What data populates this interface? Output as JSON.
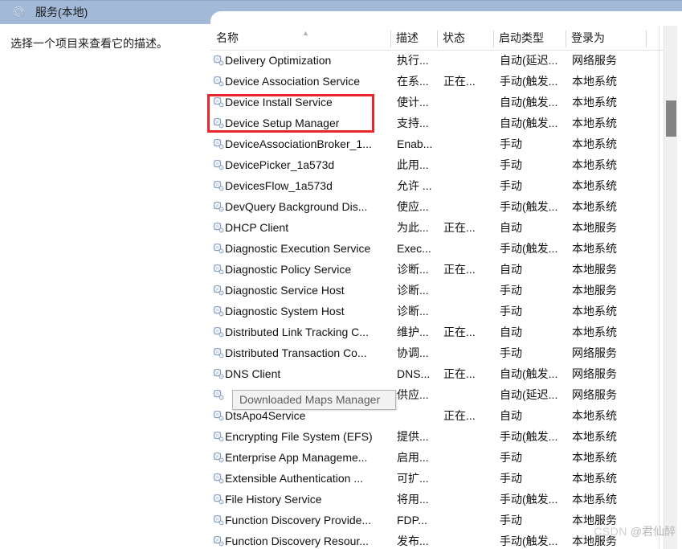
{
  "window": {
    "title": "服务(本地)",
    "title_icon": "services-gear-icon"
  },
  "left_pane": {
    "description": "选择一个项目来查看它的描述。"
  },
  "list": {
    "columns": [
      {
        "key": "name",
        "label": "名称",
        "sort": "ascending"
      },
      {
        "key": "desc",
        "label": "描述"
      },
      {
        "key": "state",
        "label": "状态"
      },
      {
        "key": "startup",
        "label": "启动类型"
      },
      {
        "key": "logon",
        "label": "登录为"
      }
    ],
    "rows": [
      {
        "name": "Delivery Optimization",
        "desc": "执行...",
        "state": "",
        "startup": "自动(延迟...",
        "logon": "网络服务"
      },
      {
        "name": "Device Association Service",
        "desc": "在系...",
        "state": "正在...",
        "startup": "手动(触发...",
        "logon": "本地系统"
      },
      {
        "name": "Device Install Service",
        "desc": "使计...",
        "state": "",
        "startup": "自动(触发...",
        "logon": "本地系统"
      },
      {
        "name": "Device Setup Manager",
        "desc": "支持...",
        "state": "",
        "startup": "自动(触发...",
        "logon": "本地系统"
      },
      {
        "name": "DeviceAssociationBroker_1...",
        "desc": "Enab...",
        "state": "",
        "startup": "手动",
        "logon": "本地系统"
      },
      {
        "name": "DevicePicker_1a573d",
        "desc": "此用...",
        "state": "",
        "startup": "手动",
        "logon": "本地系统"
      },
      {
        "name": "DevicesFlow_1a573d",
        "desc": "允许 ...",
        "state": "",
        "startup": "手动",
        "logon": "本地系统"
      },
      {
        "name": "DevQuery Background Dis...",
        "desc": "使应...",
        "state": "",
        "startup": "手动(触发...",
        "logon": "本地系统"
      },
      {
        "name": "DHCP Client",
        "desc": "为此...",
        "state": "正在...",
        "startup": "自动",
        "logon": "本地服务"
      },
      {
        "name": "Diagnostic Execution Service",
        "desc": "Exec...",
        "state": "",
        "startup": "手动(触发...",
        "logon": "本地系统"
      },
      {
        "name": "Diagnostic Policy Service",
        "desc": "诊断...",
        "state": "正在...",
        "startup": "自动",
        "logon": "本地服务"
      },
      {
        "name": "Diagnostic Service Host",
        "desc": "诊断...",
        "state": "",
        "startup": "手动",
        "logon": "本地服务"
      },
      {
        "name": "Diagnostic System Host",
        "desc": "诊断...",
        "state": "",
        "startup": "手动",
        "logon": "本地系统"
      },
      {
        "name": "Distributed Link Tracking C...",
        "desc": "维护...",
        "state": "正在...",
        "startup": "自动",
        "logon": "本地系统"
      },
      {
        "name": "Distributed Transaction Co...",
        "desc": "协调...",
        "state": "",
        "startup": "手动",
        "logon": "网络服务"
      },
      {
        "name": "DNS Client",
        "desc": "DNS...",
        "state": "正在...",
        "startup": "自动(触发...",
        "logon": "网络服务"
      },
      {
        "name": "Downloaded Maps Manager",
        "desc": "供应...",
        "state": "",
        "startup": "自动(延迟...",
        "logon": "网络服务"
      },
      {
        "name": "DtsApo4Service",
        "desc": "",
        "state": "正在...",
        "startup": "自动",
        "logon": "本地系统"
      },
      {
        "name": "Encrypting File System (EFS)",
        "desc": "提供...",
        "state": "",
        "startup": "手动(触发...",
        "logon": "本地系统"
      },
      {
        "name": "Enterprise App Manageme...",
        "desc": "启用...",
        "state": "",
        "startup": "手动",
        "logon": "本地系统"
      },
      {
        "name": "Extensible Authentication ...",
        "desc": "可扩...",
        "state": "",
        "startup": "手动",
        "logon": "本地系统"
      },
      {
        "name": "File History Service",
        "desc": "将用...",
        "state": "",
        "startup": "手动(触发...",
        "logon": "本地系统"
      },
      {
        "name": "Function Discovery Provide...",
        "desc": "FDP...",
        "state": "",
        "startup": "手动",
        "logon": "本地服务"
      },
      {
        "name": "Function Discovery Resour...",
        "desc": "发布...",
        "state": "",
        "startup": "手动(触发...",
        "logon": "本地服务"
      }
    ]
  },
  "annotations": {
    "red_box": {
      "color": "#e8262b",
      "covers": [
        "Device Install Service",
        "Device Setup Manager"
      ]
    },
    "tooltip": {
      "text": "Downloaded Maps Manager"
    }
  },
  "scrollbar": {
    "orientation": "vertical",
    "thumb_position": "near-top"
  },
  "watermark": {
    "site": "CSDN",
    "author": "@君仙醉"
  }
}
